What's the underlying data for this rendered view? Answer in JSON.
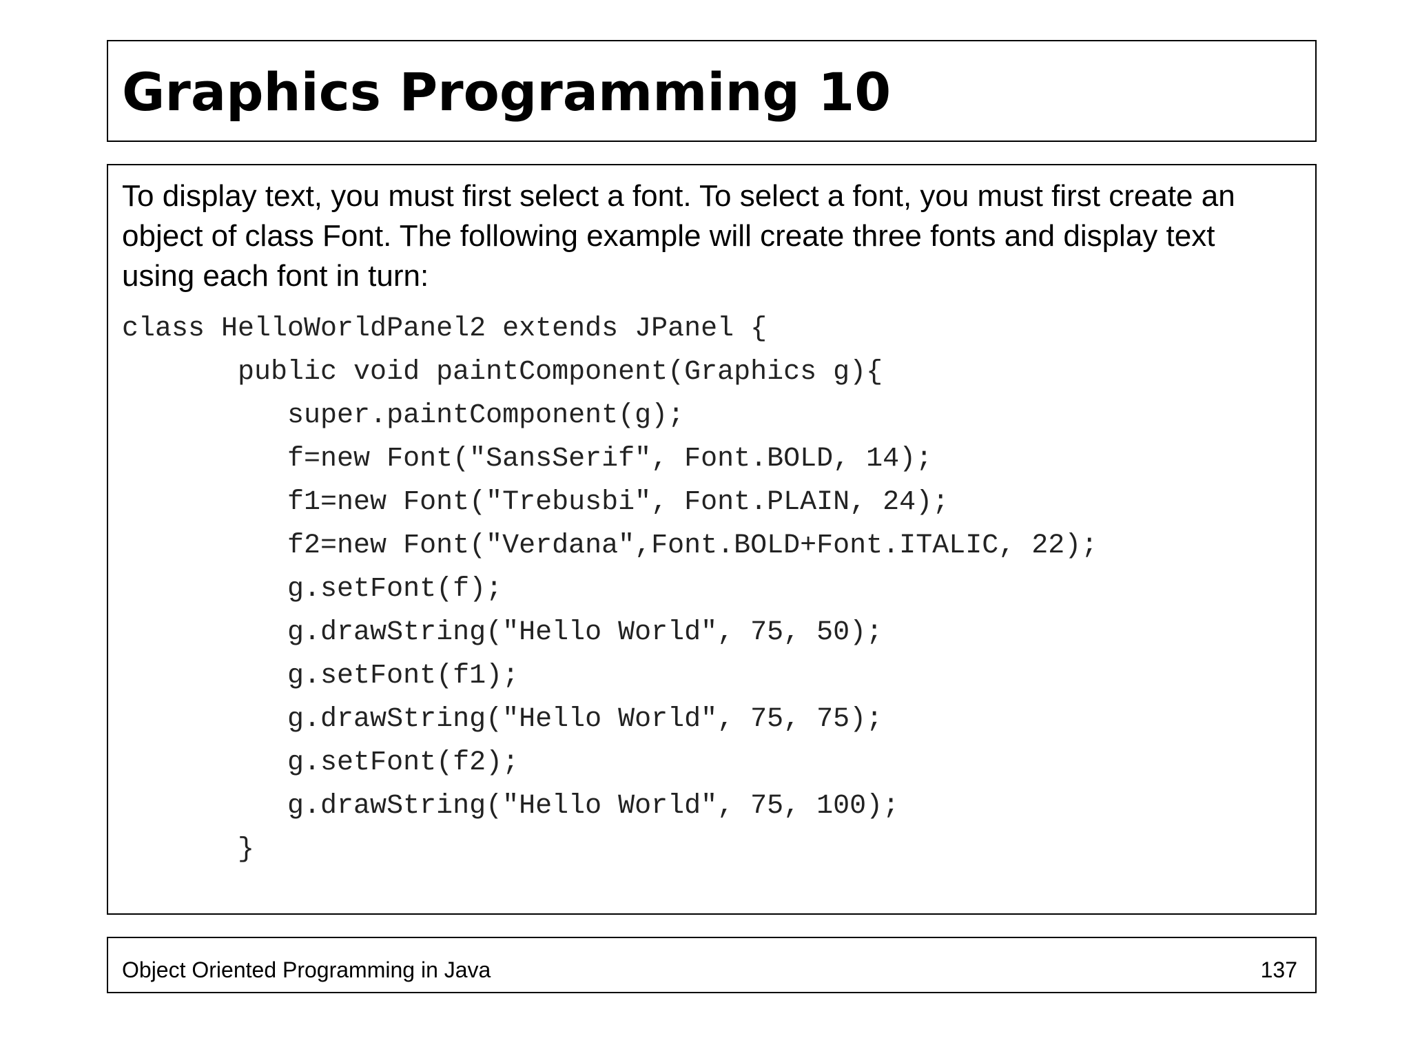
{
  "slide": {
    "title": "Graphics Programming 10",
    "intro": "To display text, you must first select a font.  To select a font, you must first create an object of class Font.  The following example will create three fonts and display text using each font in turn:",
    "code_lines": [
      "class HelloWorldPanel2 extends JPanel {",
      "       public void paintComponent(Graphics g){",
      "          super.paintComponent(g);",
      "          f=new Font(\"SansSerif\", Font.BOLD, 14);",
      "          f1=new Font(\"Trebusbi\", Font.PLAIN, 24);",
      "          f2=new Font(\"Verdana\",Font.BOLD+Font.ITALIC, 22);",
      "          g.setFont(f);",
      "          g.drawString(\"Hello World\", 75, 50);",
      "          g.setFont(f1);",
      "          g.drawString(\"Hello World\", 75, 75);",
      "          g.setFont(f2);",
      "          g.drawString(\"Hello World\", 75, 100);",
      "       }"
    ],
    "footer": {
      "course": "Object Oriented Programming in Java",
      "page_number": "137"
    }
  }
}
